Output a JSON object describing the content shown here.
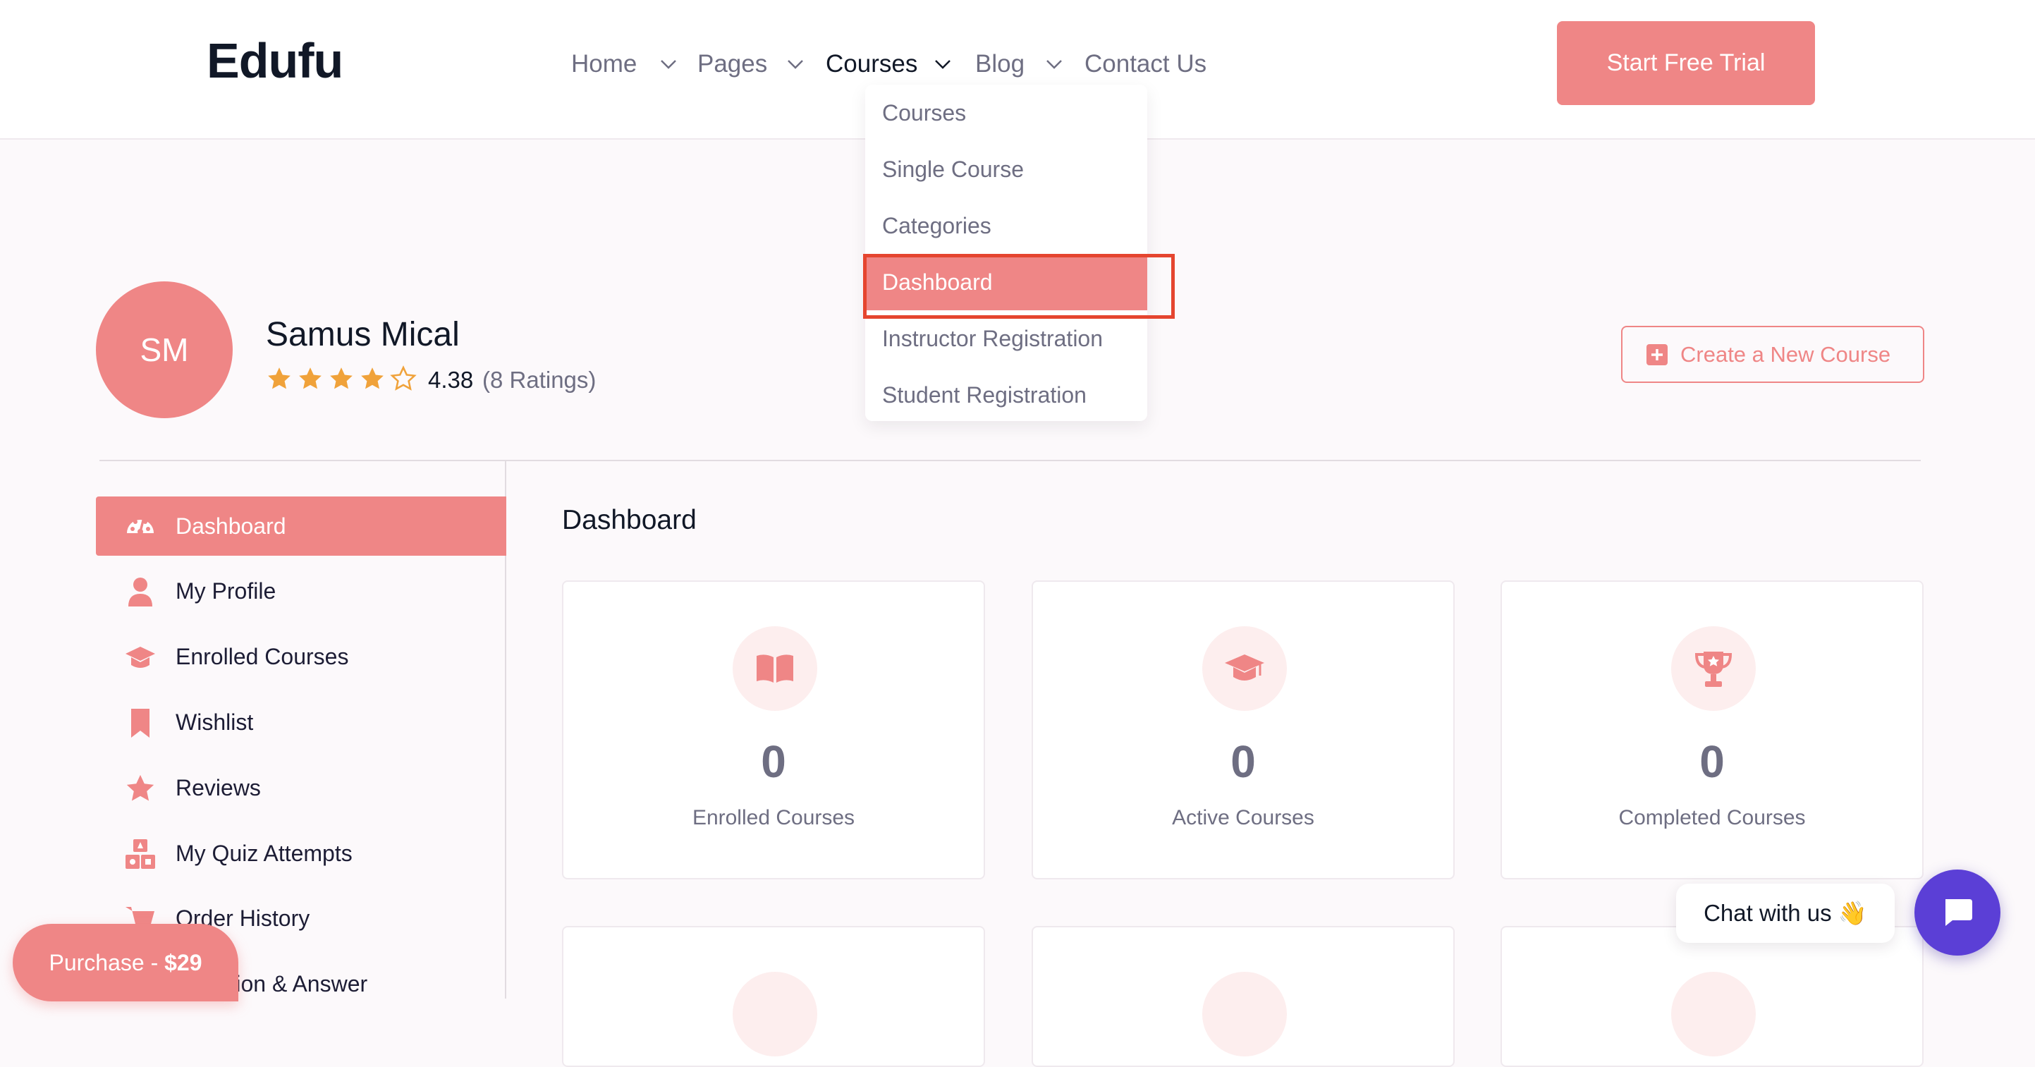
{
  "brand": {
    "logo": "Edufu",
    "accent": "#ef8686",
    "highlight_outline": "#e5452f"
  },
  "nav": {
    "items": [
      {
        "label": "Home",
        "has_dropdown": true
      },
      {
        "label": "Pages",
        "has_dropdown": true
      },
      {
        "label": "Courses",
        "has_dropdown": true,
        "active": true
      },
      {
        "label": "Blog",
        "has_dropdown": true
      },
      {
        "label": "Contact Us",
        "has_dropdown": false
      }
    ],
    "cta_label": "Start Free Trial"
  },
  "courses_dropdown": {
    "items": [
      {
        "label": "Courses"
      },
      {
        "label": "Single Course"
      },
      {
        "label": "Categories"
      },
      {
        "label": "Dashboard",
        "active": true
      },
      {
        "label": "Instructor Registration"
      },
      {
        "label": "Student Registration"
      }
    ]
  },
  "profile": {
    "initials": "SM",
    "name": "Samus Mical",
    "rating_value": "4.38",
    "rating_count": "(8 Ratings)",
    "stars_filled": 4,
    "stars_total": 5,
    "create_course_label": "Create a New Course"
  },
  "sidebar": {
    "items": [
      {
        "label": "Dashboard",
        "icon": "dashboard-gauge-icon",
        "active": true
      },
      {
        "label": "My Profile",
        "icon": "user-icon"
      },
      {
        "label": "Enrolled Courses",
        "icon": "graduation-cap-icon"
      },
      {
        "label": "Wishlist",
        "icon": "bookmark-icon"
      },
      {
        "label": "Reviews",
        "icon": "star-icon"
      },
      {
        "label": "My Quiz Attempts",
        "icon": "quiz-shapes-icon"
      },
      {
        "label": "Order History",
        "icon": "cart-icon"
      },
      {
        "label": "Question & Answer",
        "icon": "question-icon"
      }
    ]
  },
  "main": {
    "title": "Dashboard",
    "stats": [
      {
        "value": "0",
        "label": "Enrolled Courses",
        "icon": "open-book-icon"
      },
      {
        "value": "0",
        "label": "Active Courses",
        "icon": "graduation-cap-icon"
      },
      {
        "value": "0",
        "label": "Completed Courses",
        "icon": "trophy-icon"
      }
    ]
  },
  "chat": {
    "bubble_text": "Chat with us 👋",
    "button_icon": "chat-icon"
  },
  "purchase": {
    "prefix": "Purchase - ",
    "price": "$29"
  }
}
